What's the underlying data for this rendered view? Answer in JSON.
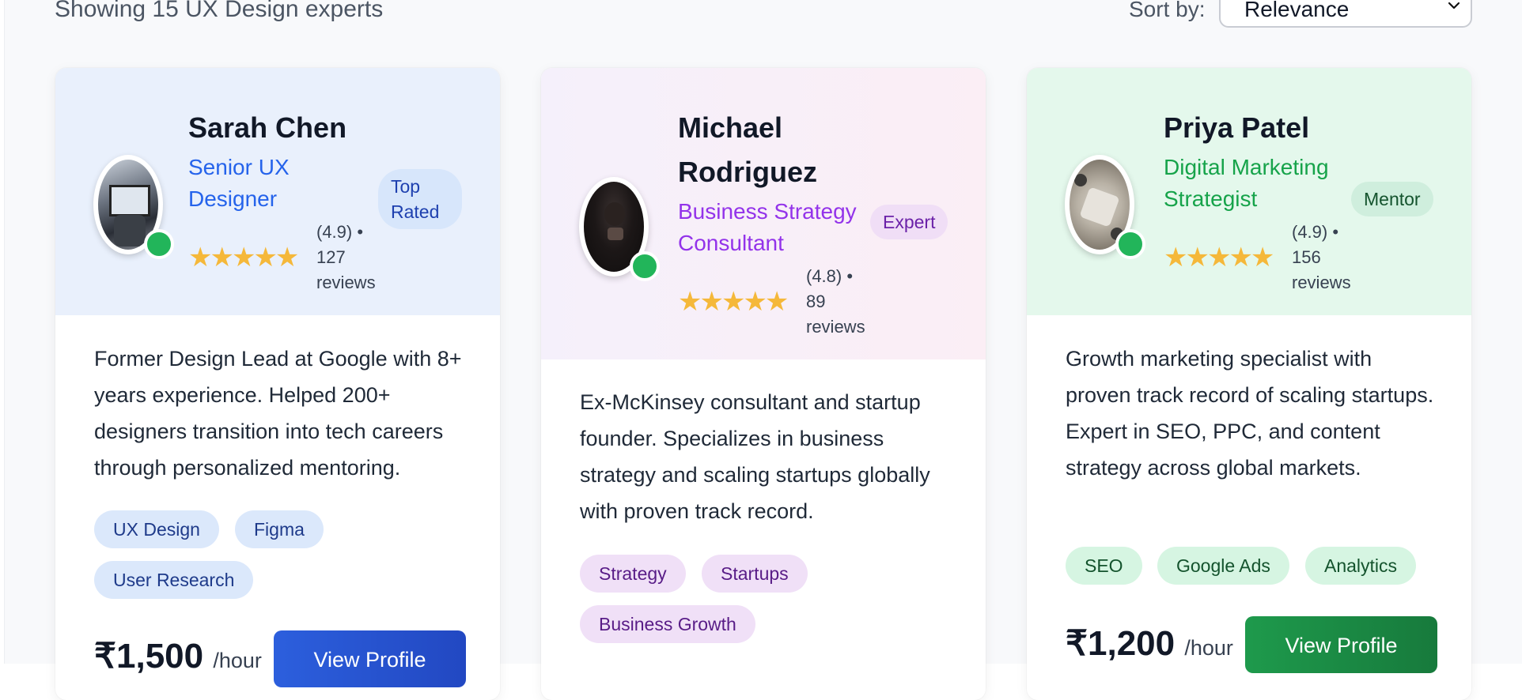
{
  "header": {
    "results_text": "Showing 15 UX Design experts",
    "sort_label": "Sort by:",
    "sort_value": "Relevance"
  },
  "experts": [
    {
      "name_line1": "Sarah Chen",
      "name_line2": "",
      "title_line1": "Senior UX",
      "title_line2": "Designer",
      "badge_line1": "Top",
      "badge_line2": "Rated",
      "stars": "★★★★★",
      "rating_line1": "(4.9) •",
      "rating_line2": "127",
      "rating_line3": "reviews",
      "description": "Former Design Lead at Google with 8+ years experience. Helped 200+ designers transition into tech careers through personalized mentoring.",
      "tags": [
        "UX Design",
        "Figma",
        "User Research"
      ],
      "price": "₹1,500",
      "per_hour": "/hour",
      "button_label": "View Profile",
      "theme_color": "#2563eb",
      "header_bg": "#eaf1fd"
    },
    {
      "name_line1": "Michael",
      "name_line2": "Rodriguez",
      "title_line1": "Business Strategy",
      "title_line2": "Consultant",
      "badge_line1": "Expert",
      "badge_line2": "",
      "stars": "★★★★★",
      "rating_line1": "(4.8) •",
      "rating_line2": "89",
      "rating_line3": "reviews",
      "description": "Ex-McKinsey consultant and startup founder. Specializes in business strategy and scaling startups globally with proven track record.",
      "tags": [
        "Strategy",
        "Startups",
        "Business Growth"
      ],
      "price": "",
      "per_hour": "",
      "button_label": "",
      "theme_color": "#9333ea",
      "header_bg": "#f8eef8"
    },
    {
      "name_line1": "Priya Patel",
      "name_line2": "",
      "title_line1": "Digital Marketing",
      "title_line2": "Strategist",
      "badge_line1": "Mentor",
      "badge_line2": "",
      "stars": "★★★★★",
      "rating_line1": "(4.9) •",
      "rating_line2": "156",
      "rating_line3": "reviews",
      "description": "Growth marketing specialist with proven track record of scaling startups. Expert in SEO, PPC, and content strategy across global markets.",
      "tags": [
        "SEO",
        "Google Ads",
        "Analytics"
      ],
      "price": "₹1,200",
      "per_hour": "/hour",
      "button_label": "View Profile",
      "theme_color": "#16a34a",
      "header_bg": "#e6f8ee"
    }
  ]
}
